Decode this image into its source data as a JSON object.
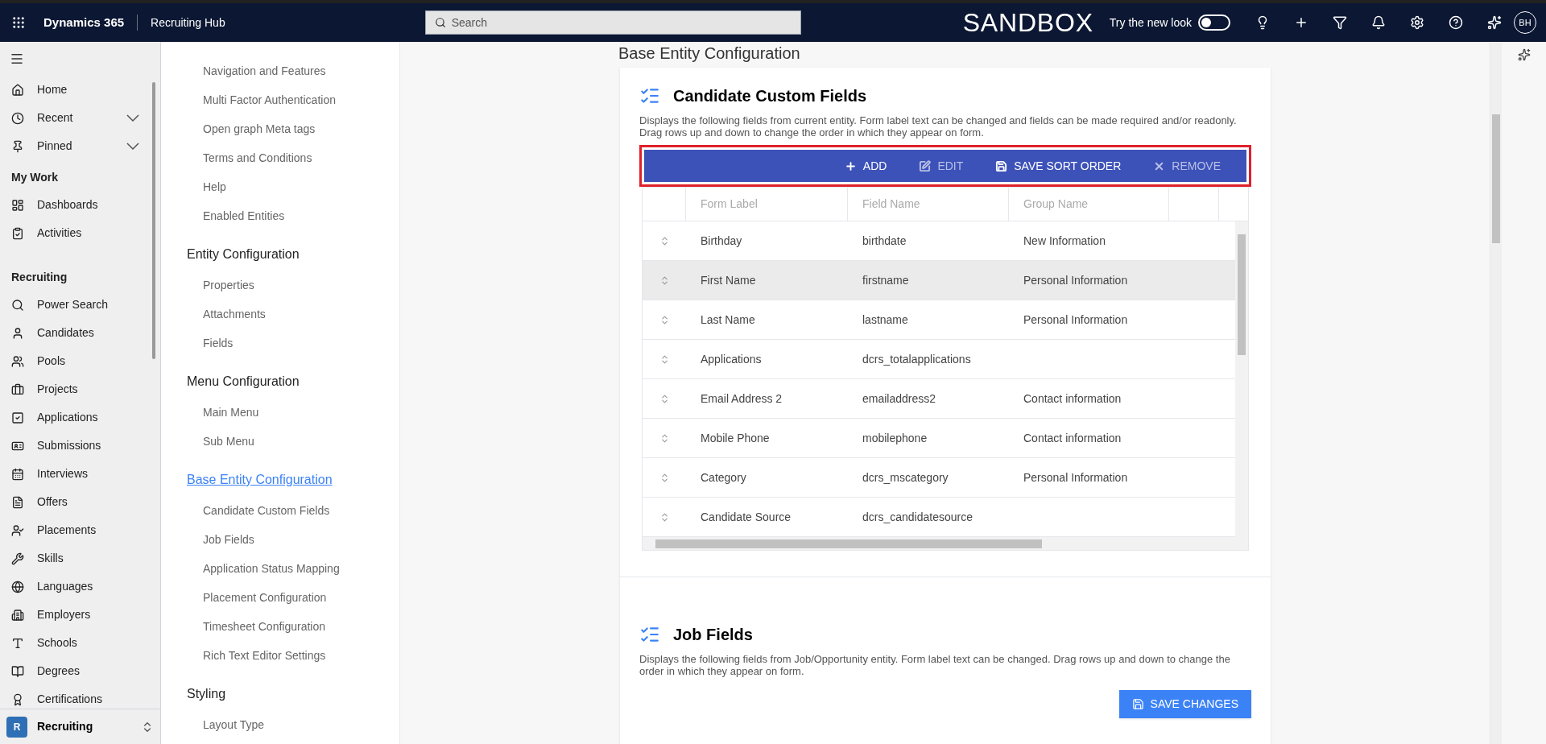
{
  "topbar": {
    "app_name": "Dynamics 365",
    "area_name": "Recruiting Hub",
    "search": {
      "placeholder": "Search"
    },
    "environment": "SANDBOX",
    "new_look": {
      "label": "Try the new look",
      "on": false
    },
    "avatar": "BH"
  },
  "left_nav": {
    "sections": [
      {
        "items": [
          {
            "label": "Home",
            "expandable": false
          },
          {
            "label": "Recent",
            "expandable": true
          },
          {
            "label": "Pinned",
            "expandable": true
          }
        ]
      },
      {
        "title": "My Work",
        "items": [
          {
            "label": "Dashboards",
            "expandable": false
          },
          {
            "label": "Activities",
            "expandable": false
          }
        ]
      },
      {
        "title": "Recruiting",
        "items": [
          {
            "label": "Power Search",
            "expandable": false
          },
          {
            "label": "Candidates",
            "expandable": false
          },
          {
            "label": "Pools",
            "expandable": false
          },
          {
            "label": "Projects",
            "expandable": false
          },
          {
            "label": "Applications",
            "expandable": false
          },
          {
            "label": "Submissions",
            "expandable": false
          },
          {
            "label": "Interviews",
            "expandable": false
          },
          {
            "label": "Offers",
            "expandable": false
          },
          {
            "label": "Placements",
            "expandable": false
          },
          {
            "label": "Skills",
            "expandable": false
          },
          {
            "label": "Languages",
            "expandable": false
          },
          {
            "label": "Employers",
            "expandable": false
          },
          {
            "label": "Schools",
            "expandable": false
          },
          {
            "label": "Degrees",
            "expandable": false
          },
          {
            "label": "Certifications",
            "expandable": false
          }
        ]
      }
    ],
    "area_switcher": {
      "initial": "R",
      "label": "Recruiting"
    }
  },
  "settings_nav": {
    "groups": [
      {
        "items": [
          "Navigation and Features",
          "Multi Factor Authentication",
          "Open graph Meta tags",
          "Terms and Conditions",
          "Help",
          "Enabled Entities"
        ]
      },
      {
        "title": "Entity Configuration",
        "selected": false,
        "items": [
          "Properties",
          "Attachments",
          "Fields"
        ]
      },
      {
        "title": "Menu Configuration",
        "selected": false,
        "items": [
          "Main Menu",
          "Sub Menu"
        ]
      },
      {
        "title": "Base Entity Configuration",
        "selected": true,
        "items": [
          "Candidate Custom Fields",
          "Job Fields",
          "Application Status Mapping",
          "Placement Configuration",
          "Timesheet Configuration",
          "Rich Text Editor Settings"
        ]
      },
      {
        "title": "Styling",
        "selected": false,
        "items": [
          "Layout Type"
        ]
      }
    ]
  },
  "main": {
    "page_title": "Base Entity Configuration",
    "sections": [
      {
        "kind": "table",
        "title": "Candidate Custom Fields",
        "description": "Displays the following fields from current entity. Form label text can be changed and fields can be made required and/or readonly. Drag rows up and down to change the order in which they appear on form.",
        "toolbar": {
          "highlighted": true,
          "buttons": [
            {
              "kind": "add",
              "label": "ADD",
              "disabled": false
            },
            {
              "kind": "edit",
              "label": "EDIT",
              "disabled": true
            },
            {
              "kind": "save",
              "label": "SAVE SORT ORDER",
              "disabled": false
            },
            {
              "kind": "remove",
              "label": "REMOVE",
              "disabled": true
            }
          ]
        },
        "table": {
          "columns": [
            "Form Label",
            "Field Name",
            "Group Name"
          ],
          "rows": [
            {
              "cells": [
                "Birthday",
                "birthdate",
                "New Information"
              ],
              "highlighted": false
            },
            {
              "cells": [
                "First Name",
                "firstname",
                "Personal Information"
              ],
              "highlighted": true
            },
            {
              "cells": [
                "Last Name",
                "lastname",
                "Personal Information"
              ],
              "highlighted": false
            },
            {
              "cells": [
                "Applications",
                "dcrs_totalapplications",
                ""
              ],
              "highlighted": false
            },
            {
              "cells": [
                "Email Address 2",
                "emailaddress2",
                "Contact information"
              ],
              "highlighted": false
            },
            {
              "cells": [
                "Mobile Phone",
                "mobilephone",
                "Contact information"
              ],
              "highlighted": false
            },
            {
              "cells": [
                "Category",
                "dcrs_mscategory",
                "Personal Information"
              ],
              "highlighted": false
            },
            {
              "cells": [
                "Candidate Source",
                "dcrs_candidatesource",
                ""
              ],
              "highlighted": false
            }
          ]
        }
      },
      {
        "kind": "form",
        "title": "Job Fields",
        "description": "Displays the following fields from Job/Opportunity entity. Form label text can be changed. Drag rows up and down to change the order in which they appear on form.",
        "save_button": "SAVE CHANGES"
      }
    ]
  }
}
